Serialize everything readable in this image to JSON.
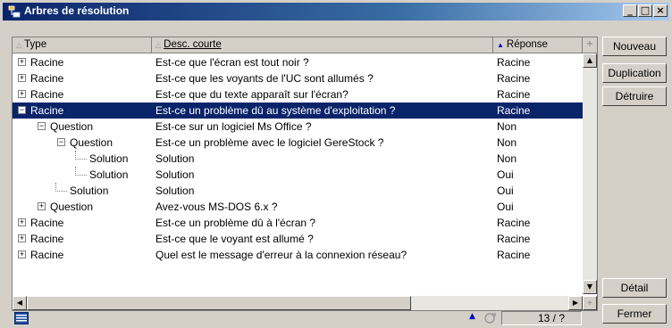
{
  "window": {
    "title": "Arbres de résolution",
    "minimize_label": "_",
    "maximize_label": "□",
    "close_label": "×"
  },
  "columns": [
    {
      "label": "Type",
      "sort_marker": "△"
    },
    {
      "label": "Desc. courte",
      "sort_marker": "△"
    },
    {
      "label": "Réponse",
      "sort_marker": "▲"
    }
  ],
  "header_corner": "+",
  "rows": [
    {
      "type": "Racine",
      "desc": "Est-ce que l'écran est tout noir ?",
      "reponse": "Racine",
      "level": 0,
      "toggle": "+"
    },
    {
      "type": "Racine",
      "desc": "Est-ce que les voyants de l'UC sont allumés ?",
      "reponse": "Racine",
      "level": 0,
      "toggle": "+"
    },
    {
      "type": "Racine",
      "desc": "Est-ce que du texte apparaît sur l'écran?",
      "reponse": "Racine",
      "level": 0,
      "toggle": "+"
    },
    {
      "type": "Racine",
      "desc": "Est-ce un problème dû au système d'exploitation ?",
      "reponse": "Racine",
      "level": 0,
      "toggle": "−",
      "selected": true
    },
    {
      "type": "Question",
      "desc": "Est-ce sur un logiciel Ms Office ?",
      "reponse": "Non",
      "level": 1,
      "toggle": "−"
    },
    {
      "type": "Question",
      "desc": "Est-ce un problème avec le logiciel GereStock ?",
      "reponse": "Non",
      "level": 2,
      "toggle": "−"
    },
    {
      "type": "Solution",
      "desc": "Solution",
      "reponse": "Non",
      "level": 3,
      "toggle": ""
    },
    {
      "type": "Solution",
      "desc": "Solution",
      "reponse": "Oui",
      "level": 3,
      "toggle": ""
    },
    {
      "type": "Solution",
      "desc": "Solution",
      "reponse": "Oui",
      "level": 2,
      "toggle": ""
    },
    {
      "type": "Question",
      "desc": "Avez-vous MS-DOS 6.x ?",
      "reponse": "Oui",
      "level": 1,
      "toggle": "+"
    },
    {
      "type": "Racine",
      "desc": "Est-ce un problème dû à l'écran ?",
      "reponse": "Racine",
      "level": 0,
      "toggle": "+"
    },
    {
      "type": "Racine",
      "desc": "Est-ce que le voyant est allumé ?",
      "reponse": "Racine",
      "level": 0,
      "toggle": "+"
    },
    {
      "type": "Racine",
      "desc": "Quel est le message d'erreur à la connexion réseau?",
      "reponse": "Racine",
      "level": 0,
      "toggle": "+"
    }
  ],
  "status": {
    "count": "13 / ?",
    "sort_marker": "▲"
  },
  "buttons": {
    "nouveau": "Nouveau",
    "duplication": "Duplication",
    "detruire": "Détruire",
    "detail": "Détail",
    "fermer": "Fermer"
  },
  "colors": {
    "title_start": "#0a246a",
    "selection": "#0a246a"
  },
  "icons": {
    "window": "tree-window-icon",
    "status": "table-view-icon",
    "status_bar": "refresh-icon"
  }
}
